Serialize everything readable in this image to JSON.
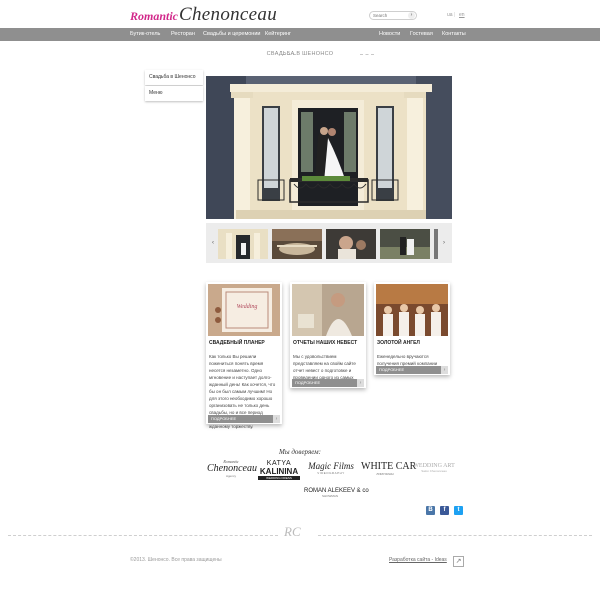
{
  "header": {
    "logo_script": "Romantic",
    "logo_main": "Chenonceau",
    "search_placeholder": "Search",
    "search_button": "›",
    "lang_ua": "ua",
    "lang_sep": "|",
    "lang_en": "en"
  },
  "nav": {
    "items": [
      "Бутик-отель",
      "Ресторан",
      "Свадьбы и церемонии",
      "Кейтеринг",
      "Новости",
      "Гостевая",
      "Контакты"
    ]
  },
  "section_title": "СВАДЬБА В ШЕНОНСО",
  "leftmenu": [
    "Свадьба в Шенонсо",
    "Меню"
  ],
  "slider": {
    "prev": "‹",
    "next": "›"
  },
  "cards": [
    {
      "title": "СВАДЕБНЫЙ ПЛАНЕР",
      "text": "Как только Вы решили пожениться понять время несется незаметно. Одно мгновение и наступает долго-жданный день! Как хочется, что бы он был самым лучшим! Но для этого необходимо хорошо организовать не только день свадьбы, но и все период подготовки и этому долго-жданному торжеству.",
      "more": "ПОДРОБНЕЕ",
      "arrow": "›"
    },
    {
      "title": "ОТЧЕТЫ НАШИХ НЕВЕСТ",
      "text": "Мы с удовольствием представляем на свойм сайте отчет невест о подготовке и проведении одного из самых важных дней в их жизни.",
      "more": "ПОДРОБНЕЕ",
      "arrow": "›"
    },
    {
      "title": "ЗОЛОТОЙ АНГЕЛ",
      "text": "Еженедельно вручаются получения премий компании Шенонсо.",
      "more": "ПОДРОБНЕЕ",
      "arrow": "›"
    }
  ],
  "trust": {
    "title": "Мы доверяем:",
    "partners": [
      {
        "line1": "Romantic",
        "line2": "Chenonceau",
        "line3": "Agency"
      },
      {
        "line1": "KATYA",
        "line2": "KALININA",
        "line3": "WEDDING DRESS"
      },
      {
        "line1": "Magic Films",
        "line2": "VIDEOGRAPHY"
      },
      {
        "line1": "WHITE CAR",
        "line2": "ЛИМУЗИНЫ"
      },
      {
        "line1": "WEDDING ART",
        "line2": "Salon Chenonceau"
      },
      {
        "line1": "ROMAN ALEKEEV & co",
        "line2": "SHOWMAN"
      }
    ]
  },
  "social": [
    "В",
    "f",
    "t"
  ],
  "footer": {
    "monogram": "RC",
    "copyright": "©2013. Шенонсо. Все права защищены",
    "dev": "Разработка сайта - Ideas",
    "up": "↗"
  },
  "colors": {
    "brand_pink": "#d2288a",
    "nav_grey": "#8f8f8f",
    "facebook": "#3b5998",
    "twitter": "#1da1f2",
    "vk": "#4a76a8"
  }
}
